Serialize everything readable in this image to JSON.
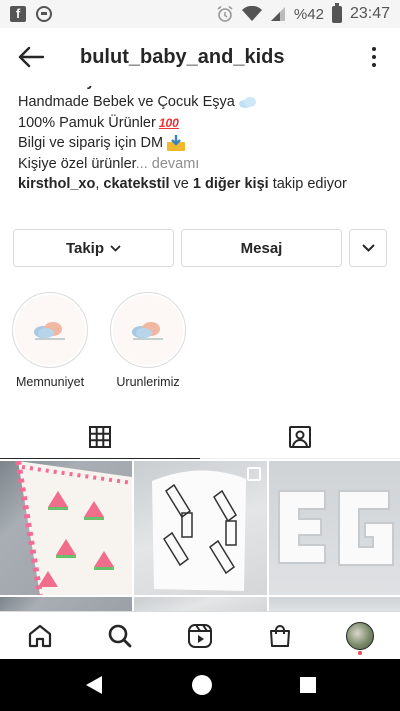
{
  "status_bar": {
    "battery": "%42",
    "time": "23:47",
    "left_icons": [
      "facebook-icon",
      "messenger-icon"
    ],
    "right_icons": [
      "alarm-icon",
      "wifi-icon",
      "signal-icon",
      "battery-icon"
    ]
  },
  "header": {
    "username": "bulut_baby_and_kids"
  },
  "bio": {
    "title": "Bulut Baby & Kids",
    "lines": [
      "Handmade Bebek ve Çocuk Eşya",
      "100% Pamuk Ürünler",
      "Bilgi ve sipariş için DM",
      "Kişiye özel ürünler"
    ],
    "more_link": "... devamı",
    "followed_by": {
      "user1": "kirsthol_xo",
      "separator": ", ",
      "user2": "ckatekstil",
      "and": " ve ",
      "others": "1 diğer kişi",
      "suffix": " takip ediyor"
    }
  },
  "actions": {
    "follow_label": "Takip",
    "message_label": "Mesaj"
  },
  "highlights": [
    {
      "label": "Memnuniyet"
    },
    {
      "label": "Urunlerimiz"
    }
  ],
  "tabs": [
    "grid-icon",
    "tagged-icon"
  ],
  "bottom_nav": [
    "home-icon",
    "search-icon",
    "reels-icon",
    "shop-icon",
    "profile-avatar"
  ],
  "colors": {
    "text": "#262626",
    "muted": "#8e8e8e",
    "border": "#dbdbdb",
    "notification": "#ed4956"
  }
}
